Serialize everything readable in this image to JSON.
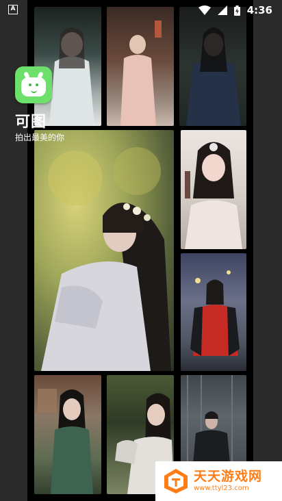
{
  "status_bar": {
    "time": "4:36",
    "left_icon": "A",
    "icons": [
      "wifi-icon",
      "signal-icon",
      "battery-charging-icon"
    ]
  },
  "app": {
    "name": "可图",
    "slogan": "拍出最美的你",
    "icon": "smiling-tv-logo-icon",
    "accent_color": "#6de06b"
  },
  "gallery": {
    "photos": [
      {
        "id": 1,
        "description": "woman-in-white-hanfu"
      },
      {
        "id": 2,
        "description": "woman-in-pink-hanfu-courtyard"
      },
      {
        "id": 3,
        "description": "man-in-dark-robe"
      },
      {
        "id": 4,
        "description": "woman-with-flower-crown-featured"
      },
      {
        "id": 5,
        "description": "woman-with-tiara"
      },
      {
        "id": 6,
        "description": "woman-in-red-dress-night"
      },
      {
        "id": 7,
        "description": "woman-in-green-qipao"
      },
      {
        "id": 8,
        "description": "woman-in-white-dress-garden"
      },
      {
        "id": 9,
        "description": "man-in-black-suit"
      }
    ]
  },
  "watermark": {
    "title": "天天游戏网",
    "url": "www.ttyl23.com",
    "color": "#ff7d16"
  }
}
